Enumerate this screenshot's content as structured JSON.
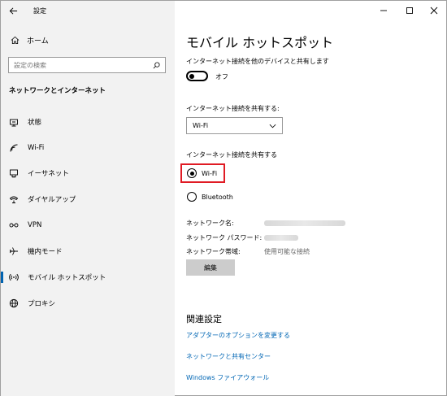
{
  "window": {
    "app_title": "設定"
  },
  "sidebar": {
    "home_label": "ホーム",
    "search_placeholder": "設定の検索",
    "section_title": "ネットワークとインターネット",
    "items": [
      {
        "label": "状態",
        "icon": "status-icon"
      },
      {
        "label": "Wi-Fi",
        "icon": "wifi-icon"
      },
      {
        "label": "イーサネット",
        "icon": "ethernet-icon"
      },
      {
        "label": "ダイヤルアップ",
        "icon": "dialup-icon"
      },
      {
        "label": "VPN",
        "icon": "vpn-icon"
      },
      {
        "label": "機内モード",
        "icon": "airplane-icon"
      },
      {
        "label": "モバイル ホットスポット",
        "icon": "hotspot-icon",
        "active": true
      },
      {
        "label": "プロキシ",
        "icon": "globe-icon"
      }
    ]
  },
  "main": {
    "title": "モバイル ホットスポット",
    "share_description": "インターネット接続を他のデバイスと共有します",
    "toggle_state": "オフ",
    "share_from_label": "インターネット接続を共有する:",
    "share_from_value": "Wi-Fi",
    "share_over_label": "インターネット接続を共有する",
    "radio_options": [
      {
        "label": "Wi-Fi",
        "selected": true
      },
      {
        "label": "Bluetooth",
        "selected": false
      }
    ],
    "network_name_label": "ネットワーク名:",
    "network_password_label": "ネットワーク パスワード:",
    "network_band_label": "ネットワーク帯域:",
    "network_band_value": "使用可能な接続",
    "edit_button": "編集"
  },
  "related": {
    "title": "関連設定",
    "links": [
      "アダプターのオプションを変更する",
      "ネットワークと共有センター",
      "Windows ファイアウォール"
    ]
  },
  "colors": {
    "accent": "#0063b1",
    "link": "#0066b4",
    "highlight": "#e01b24",
    "sidebar_bg": "#f2f2f2"
  }
}
